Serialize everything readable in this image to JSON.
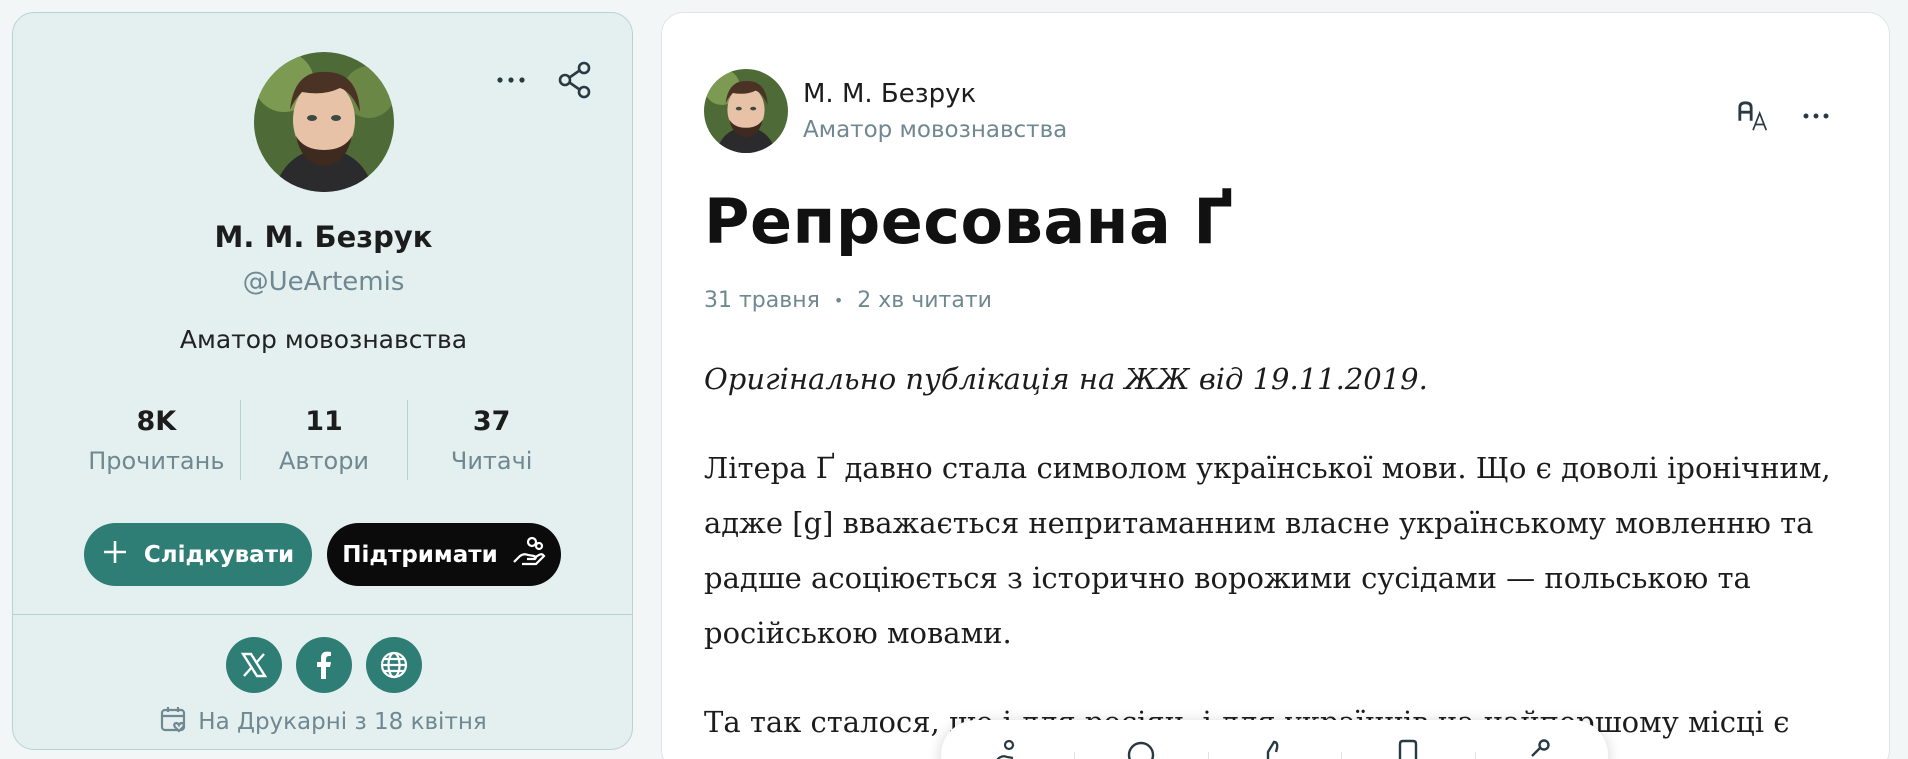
{
  "profile": {
    "name": "М. М. Безрук",
    "handle": "@UeArtemis",
    "bio": "Аматор мовознавства",
    "stats": [
      {
        "value": "8K",
        "label": "Прочитань"
      },
      {
        "value": "11",
        "label": "Автори"
      },
      {
        "value": "37",
        "label": "Читачі"
      }
    ],
    "follow_label": "Слідкувати",
    "support_label": "Підтримати",
    "socials": [
      "x-icon",
      "facebook-icon",
      "globe-icon"
    ],
    "joined": "На Друкарні з 18 квітня"
  },
  "article": {
    "author_name": "М. М. Безрук",
    "author_bio": "Аматор мовознавства",
    "title": "Репресована Ґ",
    "date": "31 травня",
    "read_time": "2 хв читати",
    "intro": "Оригінально публікація на ЖЖ від 19.11.2019.",
    "paragraph1": "Літера Ґ давно стала символом української мови. Що є доволі іронічним, адже [g] вважається непритаманним власне українському мовленню та радше асоціюється з історично ворожими сусідами — польською та російською мовами.",
    "paragraph2": "Та так сталося, що і для росіян, і для українців на найпершому місці є"
  },
  "colors": {
    "accent": "#2e7e76",
    "card_bg": "#e3f0ef",
    "muted_text": "#6f8891"
  }
}
